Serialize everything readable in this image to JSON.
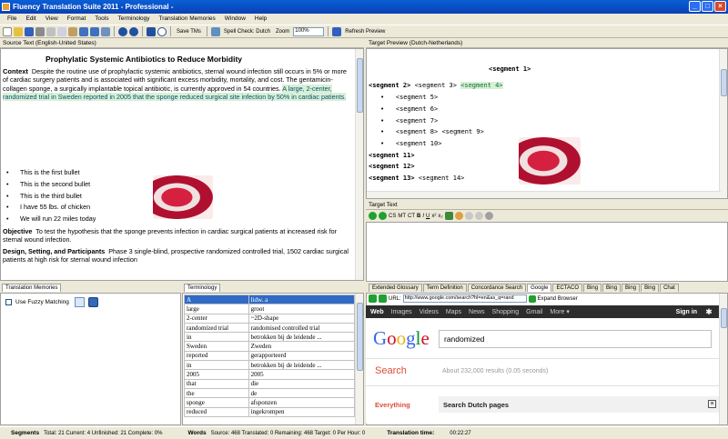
{
  "window": {
    "title": "Fluency Translation Suite 2011 - Professional -"
  },
  "menu": [
    "File",
    "Edit",
    "View",
    "Format",
    "Tools",
    "Terminology",
    "Translation Memories",
    "Window",
    "Help"
  ],
  "toolbar": {
    "save_tms": "Save TMs",
    "spell_check": "Spell Check: Dutch",
    "zoom_label": "Zoom",
    "zoom_value": "100%",
    "refresh": "Refresh Preview"
  },
  "source": {
    "header": "Source Text (English-United States)",
    "title": "Prophylatic Systemic Antibiotics to Reduce Morbidity",
    "context_label": "Context",
    "context_text": "Despite the routine use of prophylactic systemic antibiotics, sternal wound infection still occurs in 5% or more of cardiac surgery patients and is associated with significant excess morbidity, mortality, and cost. The gentamicin-collagen sponge, a surgically implantable topical antibiotic, is currently approved in 54 countries.",
    "context_highlight": "A large, 2-center, randomized trial in Sweden reported in 2005 that the sponge reduced surgical site infection by 50% in cardiac patients.",
    "bullets": [
      "This is the first bullet",
      "This is the second bullet",
      "This is the third bullet",
      "I have 55 lbs. of chicken",
      "We will run 22 miles today"
    ],
    "objective_label": "Objective",
    "objective_text": "To test the hypothesis that the sponge prevents infection in cardiac surgical patients at increased risk for sternal wound infection.",
    "design_label": "Design, Setting, and Participants",
    "design_text": "Phase 3 single-blind, prospective randomized controlled trial, 1502 cardiac surgical patients at high risk for sternal wound infection"
  },
  "target_preview": {
    "header": "Target Preview (Dutch-Netherlands)",
    "seg1": "<segment 1>",
    "seg2": "<segment 2>",
    "seg3": "<segment 3>",
    "seg4": "<segment 4>",
    "list": [
      "<segment 5>",
      "<segment 6>",
      "<segment 7>",
      "<segment 8>",
      "<segment 10>"
    ],
    "seg9": "<segment 9>",
    "seg11": "<segment 11>",
    "seg12": "<segment 12>",
    "seg13": "<segment 13>",
    "seg14": "<segment 14>"
  },
  "target_text": {
    "header": "Target Text",
    "tools": [
      "CS",
      "MT",
      "CT",
      "B",
      "I",
      "U"
    ]
  },
  "tm": {
    "header": "Translation Memories",
    "fuzzy": "Use Fuzzy Matching"
  },
  "terminology": {
    "header": "Terminology",
    "rows": [
      [
        "A",
        "lidw. a"
      ],
      [
        "large",
        "groot"
      ],
      [
        "2-center",
        "~2D-shape"
      ],
      [
        "randomized trial",
        "randomised controlled trial"
      ],
      [
        "in",
        "betrokken bij de leidende ..."
      ],
      [
        "Sweden",
        "Zweden"
      ],
      [
        "reported",
        "gerapporteerd"
      ],
      [
        "in",
        "betrokken bij de leidende ..."
      ],
      [
        "2005",
        "2005"
      ],
      [
        "that",
        "die"
      ],
      [
        "the",
        "de"
      ],
      [
        "sponge",
        "afsponzen"
      ],
      [
        "reduced",
        "ingekrompen"
      ]
    ]
  },
  "right_tabs": [
    "Extended Glossary",
    "Term Definition",
    "Concordance Search",
    "Google",
    "ECTACO",
    "Bing",
    "Bing",
    "Bing",
    "Bing",
    "Chat"
  ],
  "browser": {
    "url_label": "URL:",
    "url": "http://www.google.com/search?hl=en&as_q=rand",
    "expand": "Expand Browser",
    "nav": [
      "Web",
      "Images",
      "Videos",
      "Maps",
      "News",
      "Shopping",
      "Gmail",
      "More ▾"
    ],
    "signin": "Sign in",
    "query": "randomized",
    "search_label": "Search",
    "results": "About 232,000 results (0.05 seconds)",
    "everything": "Everything",
    "search_dutch": "Search Dutch pages"
  },
  "status": {
    "segments_label": "Segments",
    "segments_values": "Total: 21  Current: 4  Unfinished: 21  Complete: 0%",
    "words_label": "Words",
    "words_values": "Source: 468  Translated: 0  Remaining: 468  Target: 0  Per Hour: 0",
    "time_label": "Translation time:",
    "time_value": "00:22:27"
  },
  "colors": {
    "titlebar": "#0a5fd6",
    "highlight": "#d7f0d7",
    "selected_row": "#316ac5"
  }
}
